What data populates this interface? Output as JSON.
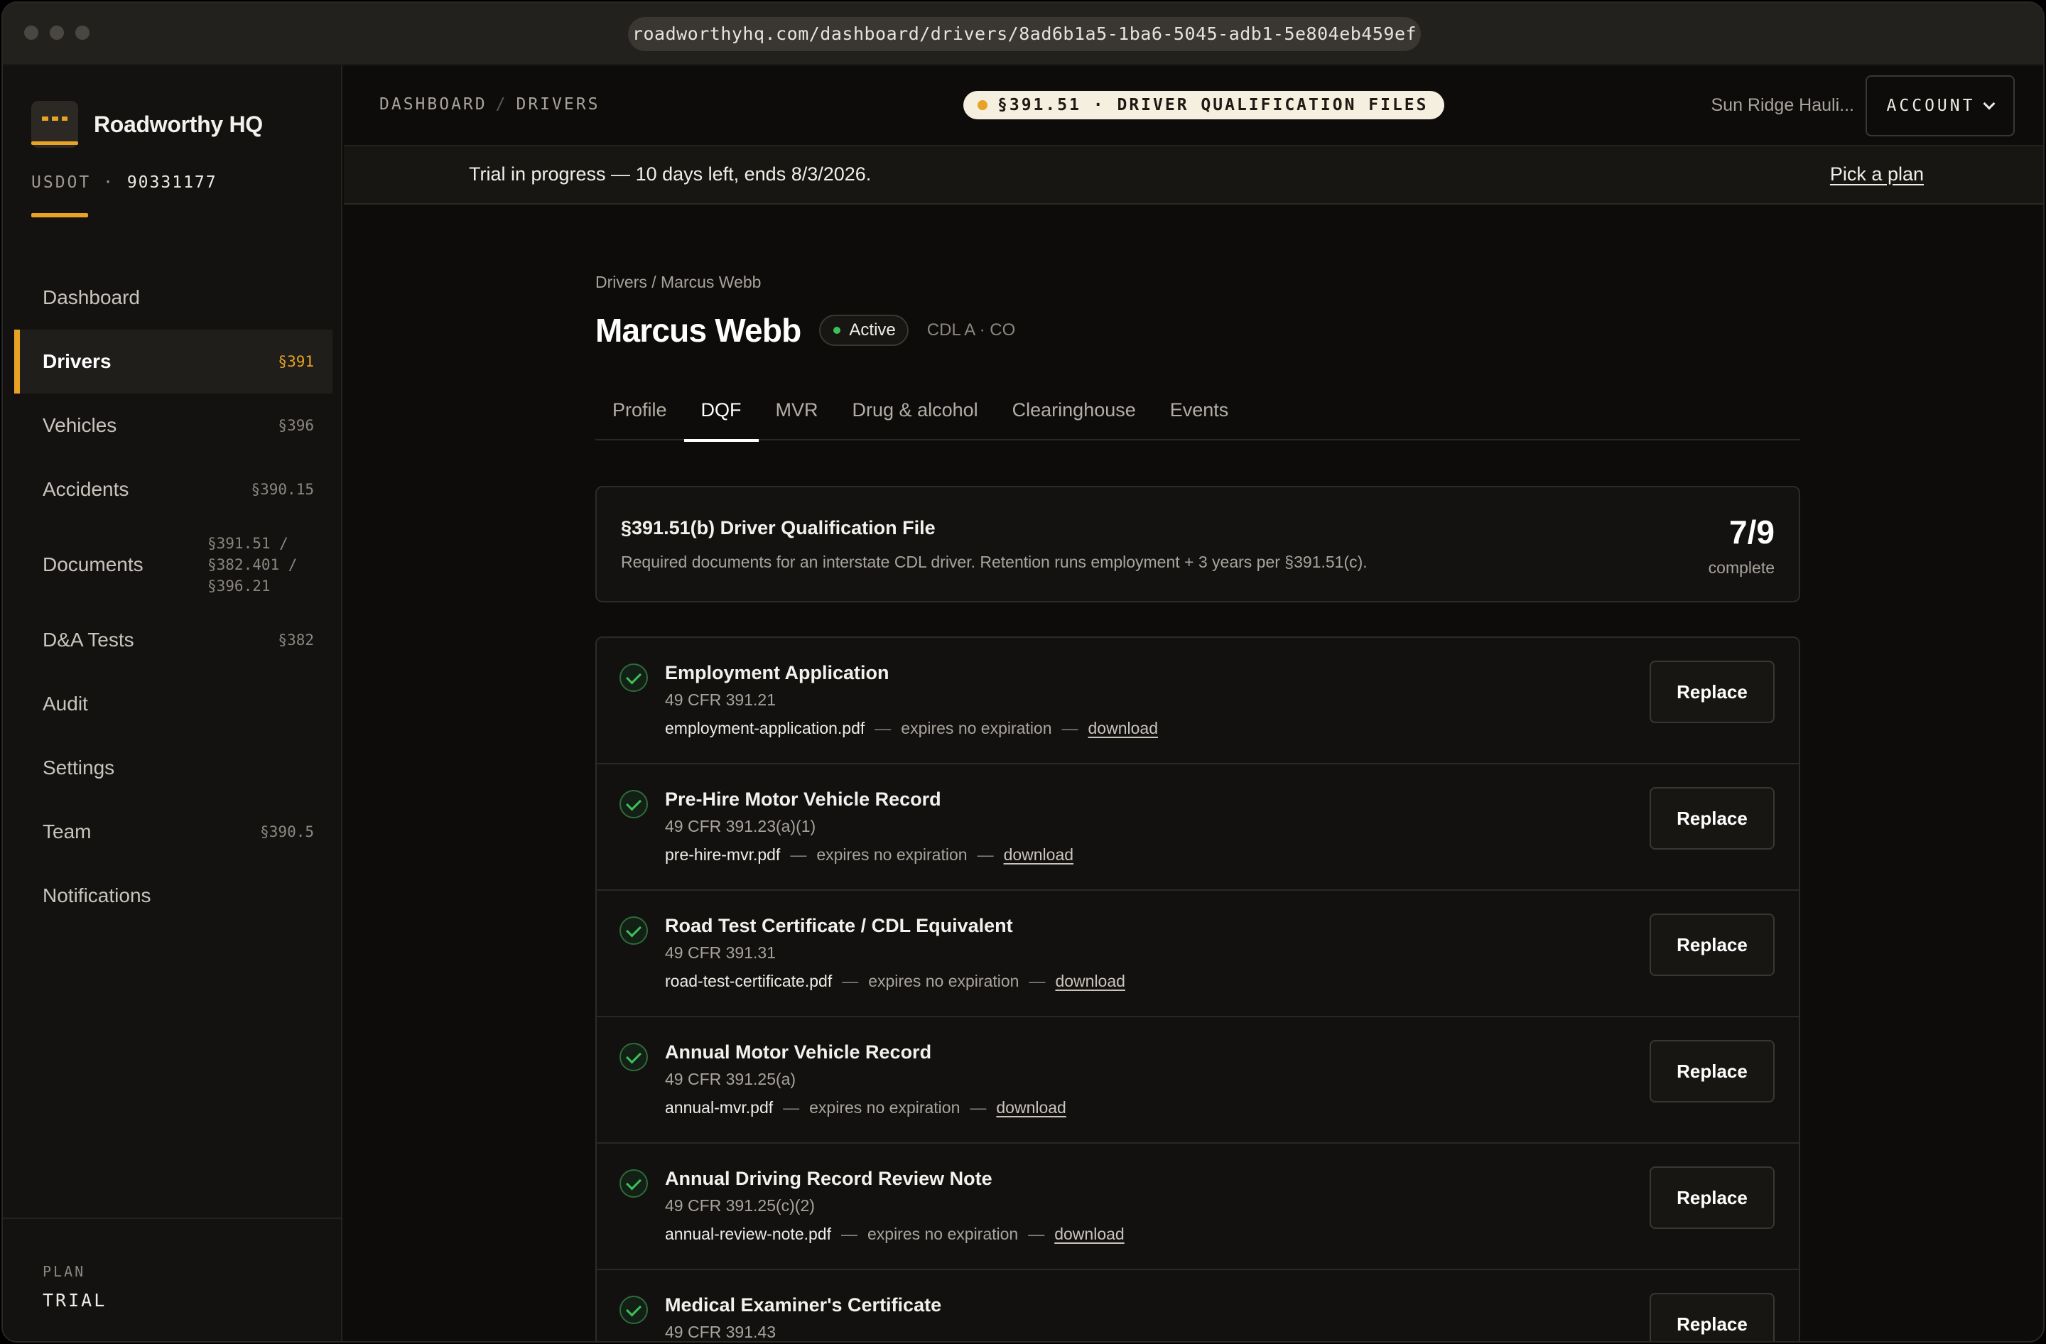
{
  "browser": {
    "url": "roadworthyhq.com/dashboard/drivers/8ad6b1a5-1ba6-5045-adb1-5e804eb459ef"
  },
  "sidebar": {
    "brand": "Roadworthy HQ",
    "usdot_label": "USDOT",
    "usdot_sep": "·",
    "usdot_number": "90331177",
    "items": [
      {
        "label": "Dashboard",
        "code": ""
      },
      {
        "label": "Drivers",
        "code": "§391"
      },
      {
        "label": "Vehicles",
        "code": "§396"
      },
      {
        "label": "Accidents",
        "code": "§390.15"
      },
      {
        "label": "Documents",
        "code": "§391.51 / §382.401 / §396.21"
      },
      {
        "label": "D&A Tests",
        "code": "§382"
      },
      {
        "label": "Audit",
        "code": ""
      },
      {
        "label": "Settings",
        "code": ""
      },
      {
        "label": "Team",
        "code": "§390.5"
      },
      {
        "label": "Notifications",
        "code": ""
      }
    ],
    "active_index": 1,
    "plan_label": "PLAN",
    "plan_value": "TRIAL"
  },
  "topbar": {
    "crumb_1": "DASHBOARD",
    "crumb_sep": "/",
    "crumb_2": "DRIVERS",
    "pill": "§391.51 · DRIVER QUALIFICATION FILES",
    "org": "Sun Ridge Hauli...",
    "account": "ACCOUNT"
  },
  "trial": {
    "text": "Trial in progress — 10 days left, ends 8/3/2026.",
    "link": "Pick a plan"
  },
  "driver": {
    "breadcrumb": "Drivers / Marcus Webb",
    "name": "Marcus Webb",
    "status": "Active",
    "license": "CDL A · CO"
  },
  "tabs": [
    "Profile",
    "DQF",
    "MVR",
    "Drug & alcohol",
    "Clearinghouse",
    "Events"
  ],
  "active_tab": 1,
  "summary": {
    "title": "§391.51(b) Driver Qualification File",
    "description": "Required documents for an interstate CDL driver. Retention runs employment + 3 years per §391.51(c).",
    "count": "7/9",
    "count_label": "complete"
  },
  "documents": [
    {
      "title": "Employment Application",
      "reg": "49 CFR 391.21",
      "file": "employment-application.pdf",
      "expires": "expires no expiration",
      "download": "download",
      "action": "Replace"
    },
    {
      "title": "Pre-Hire Motor Vehicle Record",
      "reg": "49 CFR 391.23(a)(1)",
      "file": "pre-hire-mvr.pdf",
      "expires": "expires no expiration",
      "download": "download",
      "action": "Replace"
    },
    {
      "title": "Road Test Certificate / CDL Equivalent",
      "reg": "49 CFR 391.31",
      "file": "road-test-certificate.pdf",
      "expires": "expires no expiration",
      "download": "download",
      "action": "Replace"
    },
    {
      "title": "Annual Motor Vehicle Record",
      "reg": "49 CFR 391.25(a)",
      "file": "annual-mvr.pdf",
      "expires": "expires no expiration",
      "download": "download",
      "action": "Replace"
    },
    {
      "title": "Annual Driving Record Review Note",
      "reg": "49 CFR 391.25(c)(2)",
      "file": "annual-review-note.pdf",
      "expires": "expires no expiration",
      "download": "download",
      "action": "Replace"
    },
    {
      "title": "Medical Examiner's Certificate",
      "reg": "49 CFR 391.43",
      "file": "",
      "expires": "",
      "download": "",
      "action": "Replace"
    }
  ],
  "meta_dash": "—",
  "colors": {
    "accent": "#e8a325",
    "success": "#3fbf5a",
    "background": "#0d0c0a"
  }
}
